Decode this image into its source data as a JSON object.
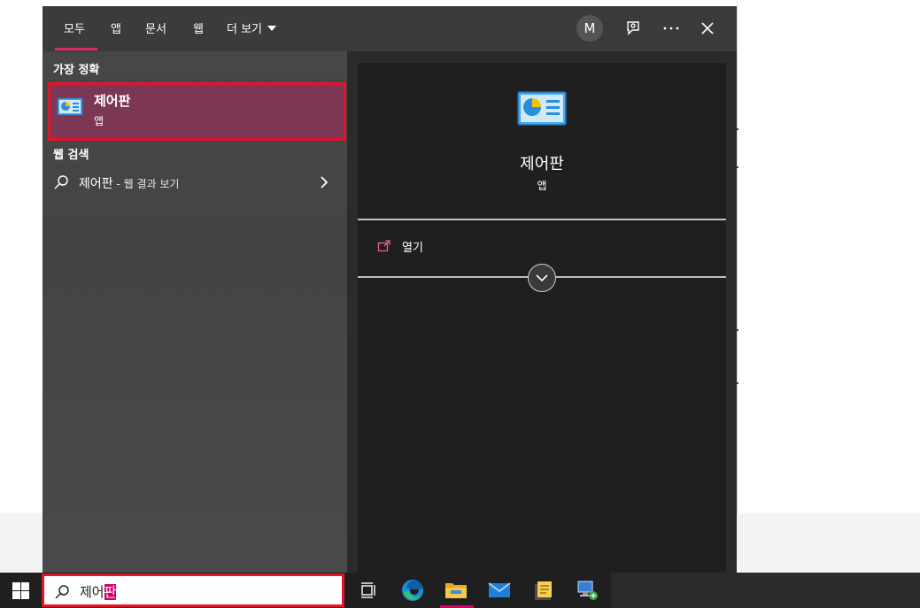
{
  "flyout": {
    "tabs": {
      "all": "모두",
      "apps": "앱",
      "documents": "문서",
      "web": "웹",
      "more": "더 보기"
    },
    "avatar_initial": "M",
    "sections": {
      "best_match": "가장 정확",
      "web_search": "웹 검색"
    },
    "best_match": {
      "title": "제어판",
      "subtitle": "앱"
    },
    "web_result": {
      "query": "제어판",
      "suffix": " - 웹 결과 보기"
    },
    "details": {
      "title": "제어판",
      "subtitle": "앱",
      "open_label": "열기"
    }
  },
  "taskbar": {
    "search_text_typed": "제어",
    "search_text_highlighted": "판"
  },
  "icons": {
    "control_panel": "control-panel-icon",
    "search": "search-icon",
    "feedback": "feedback-icon",
    "more": "ellipsis-icon",
    "close": "close-icon",
    "chevron_right": "chevron-right-icon",
    "chevron_down": "chevron-down-icon",
    "open": "open-icon",
    "windows": "windows-logo-icon",
    "task_view": "task-view-icon",
    "edge": "edge-icon",
    "file_explorer": "folder-icon",
    "mail": "mail-icon",
    "sticky_notes": "notes-icon",
    "network": "network-icon"
  },
  "colors": {
    "accent": "#d6006c",
    "highlight_border": "#e0152c",
    "best_match_bg": "#7b3753"
  }
}
